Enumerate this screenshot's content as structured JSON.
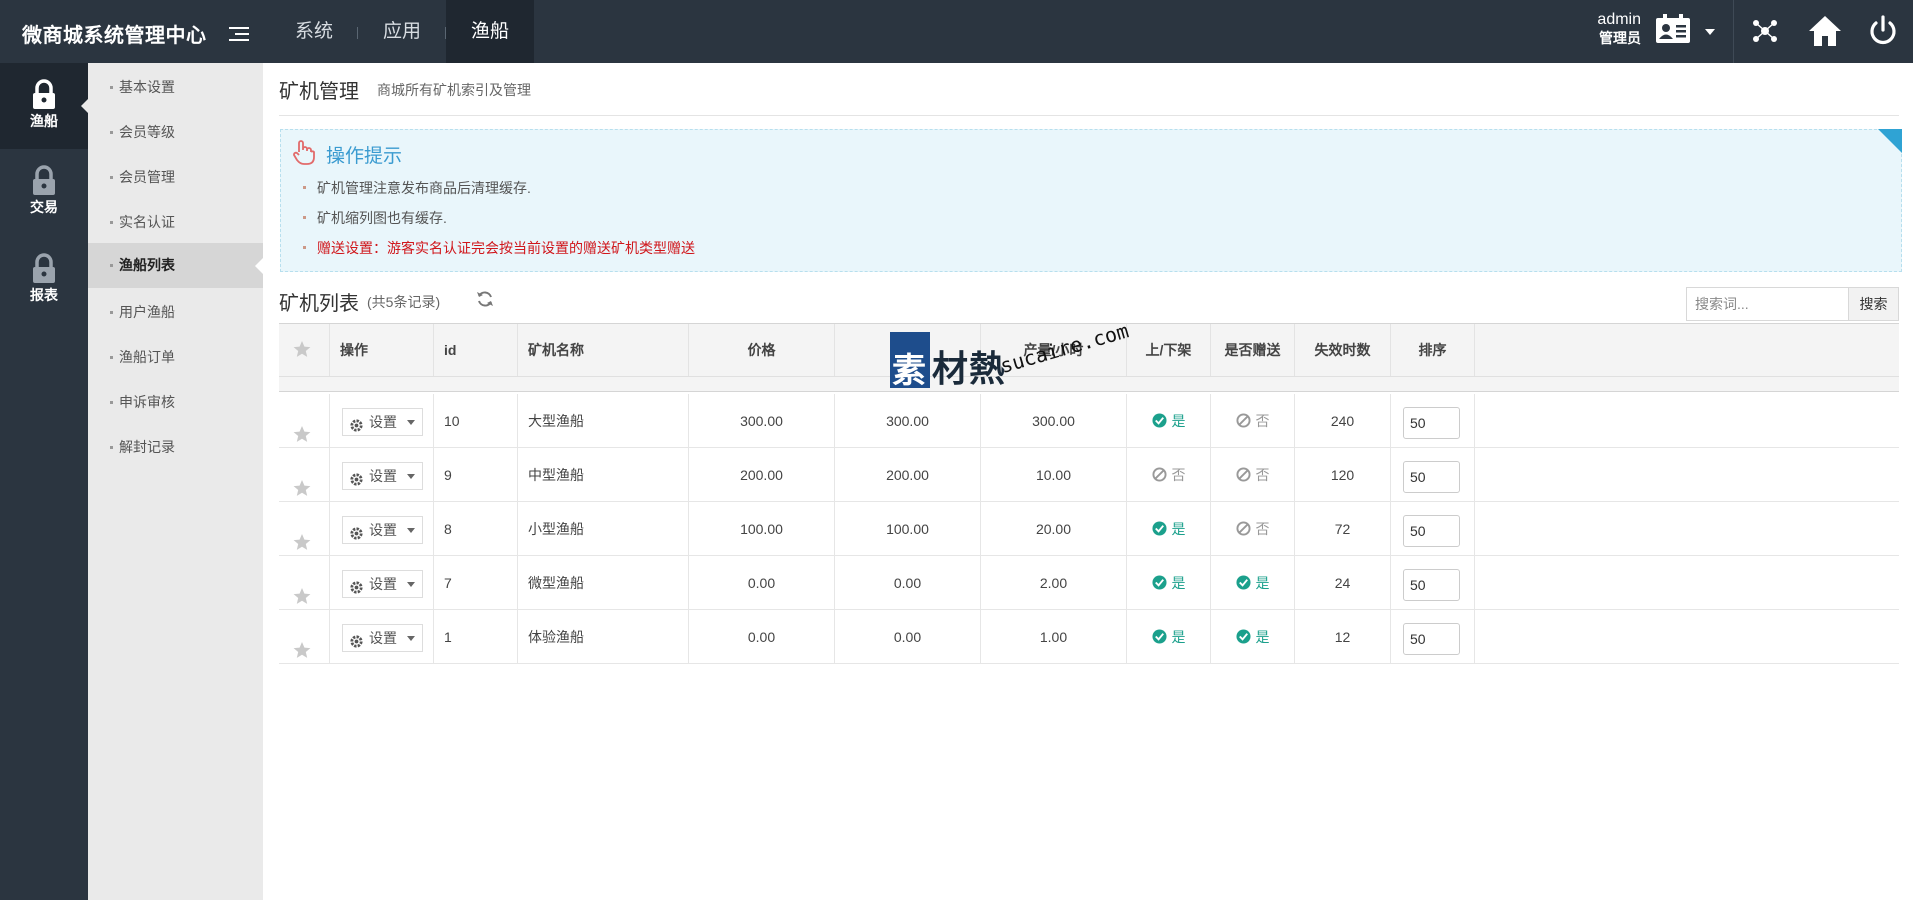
{
  "app": {
    "title": "微商城系统管理中心"
  },
  "topnav": {
    "tabs": [
      {
        "label": "系统"
      },
      {
        "label": "应用"
      },
      {
        "label": "渔船"
      }
    ]
  },
  "user": {
    "name": "admin",
    "role": "管理员"
  },
  "sidebar": {
    "items": [
      {
        "label": "渔船",
        "icon": "lock-icon"
      },
      {
        "label": "交易",
        "icon": "lock-icon"
      },
      {
        "label": "报表",
        "icon": "lock-icon"
      }
    ]
  },
  "submenu": {
    "items": [
      {
        "label": "基本设置"
      },
      {
        "label": "会员等级"
      },
      {
        "label": "会员管理"
      },
      {
        "label": "实名认证"
      },
      {
        "label": "渔船列表"
      },
      {
        "label": "用户渔船"
      },
      {
        "label": "渔船订单"
      },
      {
        "label": "申诉审核"
      },
      {
        "label": "解封记录"
      }
    ]
  },
  "page": {
    "title": "矿机管理",
    "subtitle": "商城所有矿机索引及管理"
  },
  "tips": {
    "title": "操作提示",
    "items": [
      "矿机管理注意发布商品后清理缓存.",
      "矿机缩列图也有缓存.",
      "赠送设置：游客实名认证完会按当前设置的赠送矿机类型赠送"
    ]
  },
  "list": {
    "title": "矿机列表",
    "count": "(共5条记录)"
  },
  "search": {
    "placeholder": "搜索词...",
    "button": "搜索"
  },
  "table": {
    "headers": {
      "op": "操作",
      "id": "id",
      "name": "矿机名称",
      "price": "价格",
      "output": "产量/小时",
      "shelf": "上/下架",
      "gift": "是否赠送",
      "expire": "失效时数",
      "sort": "排序"
    },
    "setting_label": "设置",
    "yes_label": "是",
    "no_label": "否",
    "rows": [
      {
        "id": "10",
        "name": "大型渔船",
        "price": "300.00",
        "col5": "300.00",
        "output": "300.00",
        "shelf": true,
        "gift": false,
        "expire": "240",
        "sort": "50"
      },
      {
        "id": "9",
        "name": "中型渔船",
        "price": "200.00",
        "col5": "200.00",
        "output": "10.00",
        "shelf": false,
        "gift": false,
        "expire": "120",
        "sort": "50"
      },
      {
        "id": "8",
        "name": "小型渔船",
        "price": "100.00",
        "col5": "100.00",
        "output": "20.00",
        "shelf": true,
        "gift": false,
        "expire": "72",
        "sort": "50"
      },
      {
        "id": "7",
        "name": "微型渔船",
        "price": "0.00",
        "col5": "0.00",
        "output": "2.00",
        "shelf": true,
        "gift": true,
        "expire": "24",
        "sort": "50"
      },
      {
        "id": "1",
        "name": "体验渔船",
        "price": "0.00",
        "col5": "0.00",
        "output": "1.00",
        "shelf": true,
        "gift": true,
        "expire": "12",
        "sort": "50"
      }
    ]
  },
  "watermark": {
    "char": "素",
    "text": "材熱",
    "url": "sucaire.com"
  },
  "colors": {
    "topbar": "#2b3540",
    "accent": "#3a9bd0",
    "yes": "#1ba08c",
    "danger": "#d0161b"
  }
}
